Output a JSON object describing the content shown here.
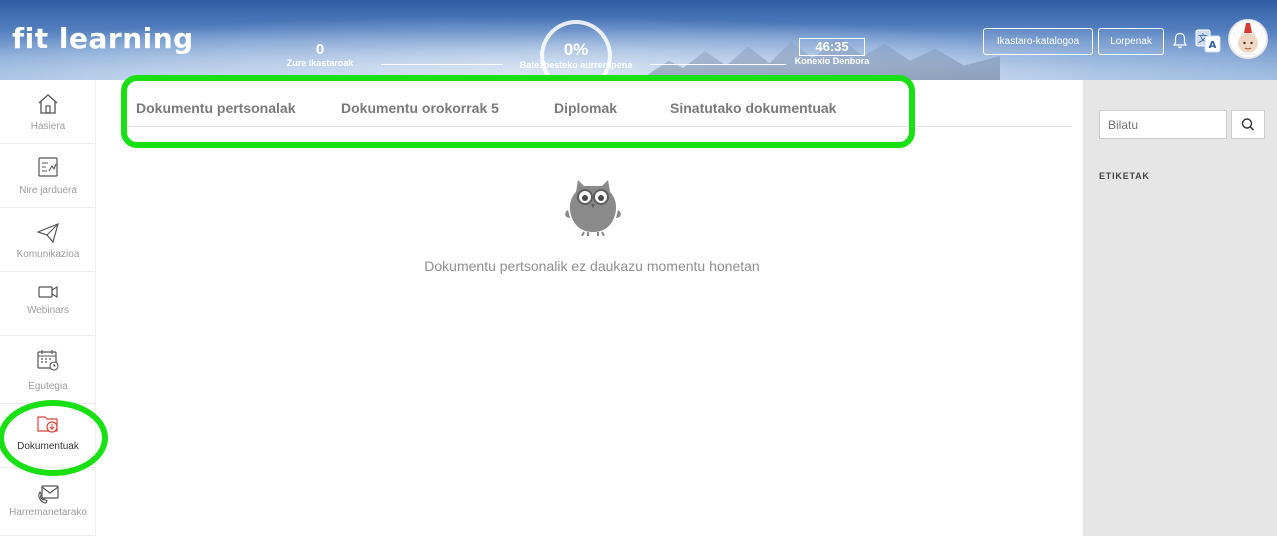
{
  "header": {
    "logo": "fit learning",
    "stats": {
      "courses_value": "0",
      "courses_label": "Zure ikastaroak",
      "progress_value": "0%",
      "progress_label": "Batezbesteko aurrerapena",
      "time_value": "46:35",
      "time_label": "Konexio Denbora"
    },
    "buttons": {
      "catalog": "Ikastaro-katalogoa",
      "achievements": "Lorpenak"
    },
    "icons": [
      "bell-icon",
      "translate-icon",
      "user-avatar"
    ]
  },
  "sidebar": {
    "items": [
      {
        "label": "Hasiera",
        "icon": "home-icon"
      },
      {
        "label": "Nire jarduera",
        "icon": "activity-icon"
      },
      {
        "label": "Komunikazioa",
        "icon": "paper-plane-icon"
      },
      {
        "label": "Webinars",
        "icon": "video-camera-icon"
      },
      {
        "label": "Egutegia",
        "icon": "calendar-icon"
      },
      {
        "label": "Dokumentuak",
        "icon": "documents-folder-icon",
        "active": true
      },
      {
        "label": "Harremanetarako",
        "icon": "contact-icon"
      }
    ]
  },
  "main": {
    "tabs": [
      {
        "label": "Dokumentu pertsonalak"
      },
      {
        "label": "Dokumentu orokorrak 5"
      },
      {
        "label": "Diplomak"
      },
      {
        "label": "Sinatutako dokumentuak"
      }
    ],
    "empty_message": "Dokumentu pertsonalik ez daukazu momentu honetan"
  },
  "right_panel": {
    "search_placeholder": "Bilatu",
    "tags_label": "ETIKETAK"
  },
  "colors": {
    "highlight": "#19e013",
    "active_icon": "#d9453a",
    "header_blue": "#3a67ad"
  }
}
